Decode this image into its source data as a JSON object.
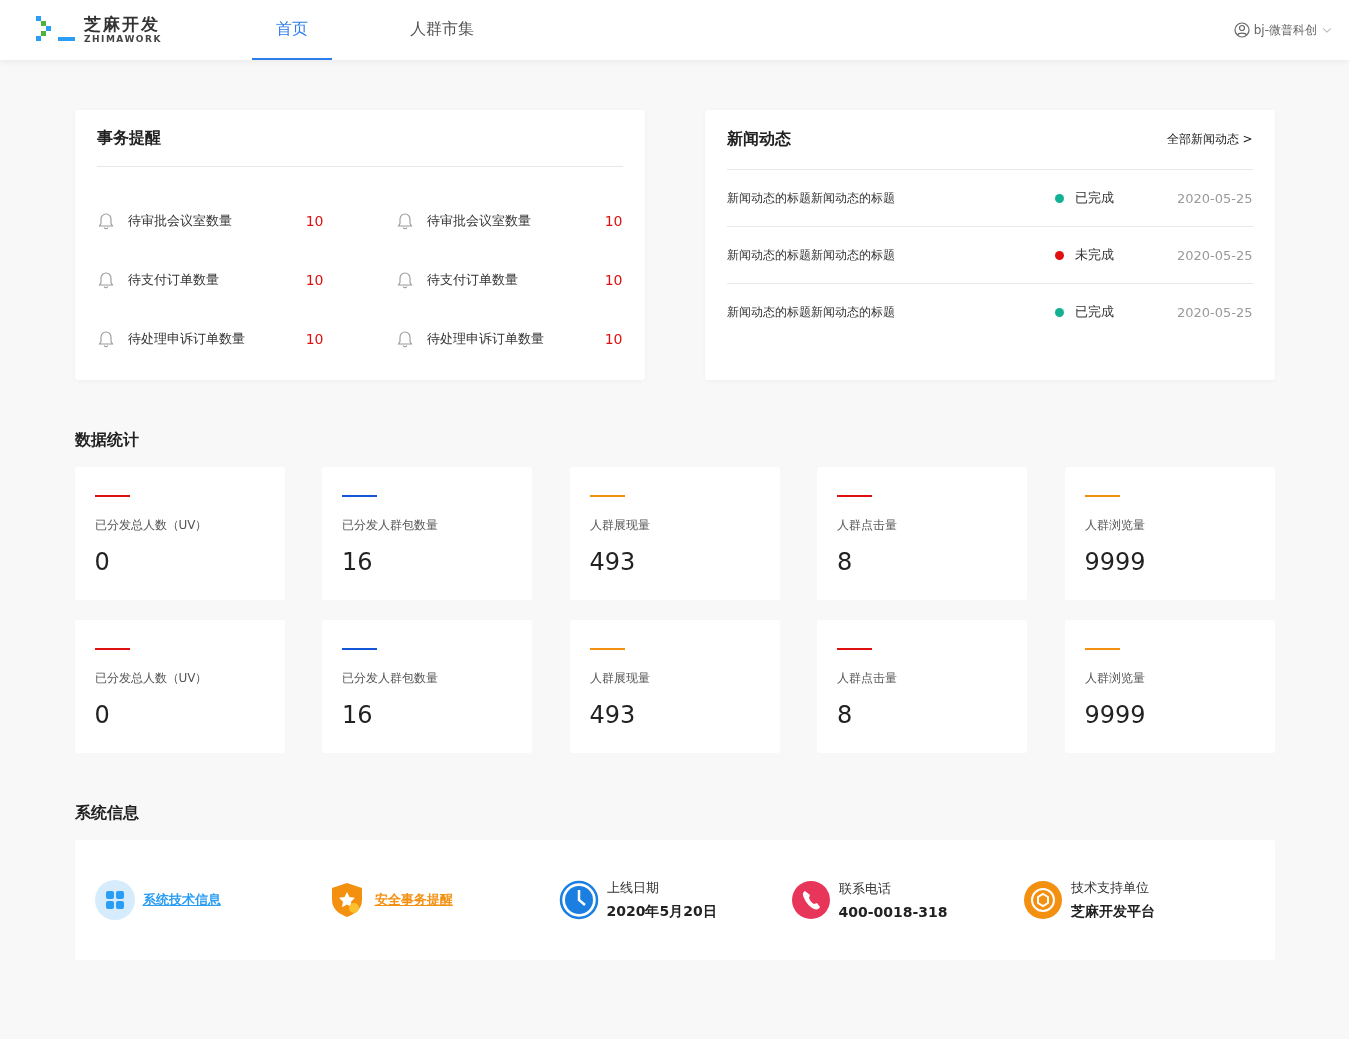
{
  "header": {
    "logo_title": "芝麻开发",
    "logo_subtitle": "ZHIMAWORK",
    "nav": [
      {
        "label": "首页",
        "selected": true
      },
      {
        "label": "人群市集",
        "selected": false
      }
    ],
    "user": "bj-微普科创"
  },
  "reminders": {
    "title": "事务提醒",
    "items": [
      {
        "label": "待审批会议室数量",
        "count": "10"
      },
      {
        "label": "待审批会议室数量",
        "count": "10"
      },
      {
        "label": "待支付订单数量",
        "count": "10"
      },
      {
        "label": "待支付订单数量",
        "count": "10"
      },
      {
        "label": "待处理申诉订单数量",
        "count": "10"
      },
      {
        "label": "待处理申诉订单数量",
        "count": "10"
      }
    ]
  },
  "news": {
    "title": "新闻动态",
    "more_link": "全部新闻动态 >",
    "items": [
      {
        "title": "新闻动态的标题新闻动态的标题",
        "status": "已完成",
        "color": "#13b193",
        "date": "2020-05-25"
      },
      {
        "title": "新闻动态的标题新闻动态的标题",
        "status": "未完成",
        "color": "#e01010",
        "date": "2020-05-25"
      },
      {
        "title": "新闻动态的标题新闻动态的标题",
        "status": "已完成",
        "color": "#13b193",
        "date": "2020-05-25"
      }
    ]
  },
  "statistics": {
    "title": "数据统计",
    "cards": [
      {
        "label": "已分发总人数（UV）",
        "value": "0",
        "color": "#e01010"
      },
      {
        "label": "已分发人群包数量",
        "value": "16",
        "color": "#1356d8"
      },
      {
        "label": "人群展现量",
        "value": "493",
        "color": "#f39010"
      },
      {
        "label": "人群点击量",
        "value": "8",
        "color": "#e01010"
      },
      {
        "label": "人群浏览量",
        "value": "9999",
        "color": "#f39010"
      },
      {
        "label": "已分发总人数（UV）",
        "value": "0",
        "color": "#e01010"
      },
      {
        "label": "已分发人群包数量",
        "value": "16",
        "color": "#1356d8"
      },
      {
        "label": "人群展现量",
        "value": "493",
        "color": "#f39010"
      },
      {
        "label": "人群点击量",
        "value": "8",
        "color": "#e01010"
      },
      {
        "label": "人群浏览量",
        "value": "9999",
        "color": "#f39010"
      }
    ]
  },
  "system_info": {
    "title": "系统信息",
    "items": [
      {
        "kind": "link",
        "label": "系统技术信息",
        "color": "#2a9df4"
      },
      {
        "kind": "link",
        "label": "安全事务提醒",
        "color": "#f39010"
      },
      {
        "kind": "info",
        "label": "上线日期",
        "value": "2020年5月20日"
      },
      {
        "kind": "info",
        "label": "联系电话",
        "value": "400-0018-318"
      },
      {
        "kind": "info",
        "label": "技术支持单位",
        "value": "芝麻开发平台"
      }
    ]
  }
}
